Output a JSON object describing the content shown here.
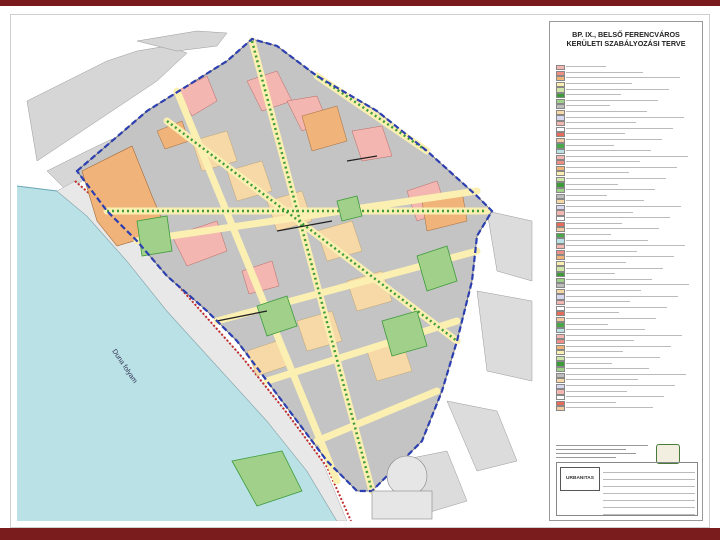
{
  "title": {
    "line1": "BP. IX., BELSŐ FERENCVÁROS",
    "line2": "KERÜLETI SZABÁLYOZÁSI TERVE"
  },
  "map": {
    "river_label": "Duna folyam",
    "colors": {
      "river": "#b9e1e6",
      "block": "#bdbdbd",
      "street": "#fbf0b2",
      "green": "#3e9b3a",
      "pink": "#f3b6b0",
      "orange": "#f0b37a",
      "boundary": "#2c3fb0",
      "red_dash": "#c22a2a",
      "band": "#7a1b1e"
    }
  },
  "legend": {
    "swatch_colors": [
      "#f3b6b0",
      "#ee8f86",
      "#f0b37a",
      "#fbf0b2",
      "#cfe6a8",
      "#3e9b3a",
      "#a0d08a",
      "#bdbdbd",
      "#f6d9a7",
      "#d8d8f0",
      "#f3b6b0",
      "#ffffff",
      "#e56c5a",
      "#f5c9a0",
      "#4aa84a",
      "#b9e1e6"
    ],
    "row_count": 62
  },
  "title_block": {
    "firm": "URBANITAS"
  }
}
